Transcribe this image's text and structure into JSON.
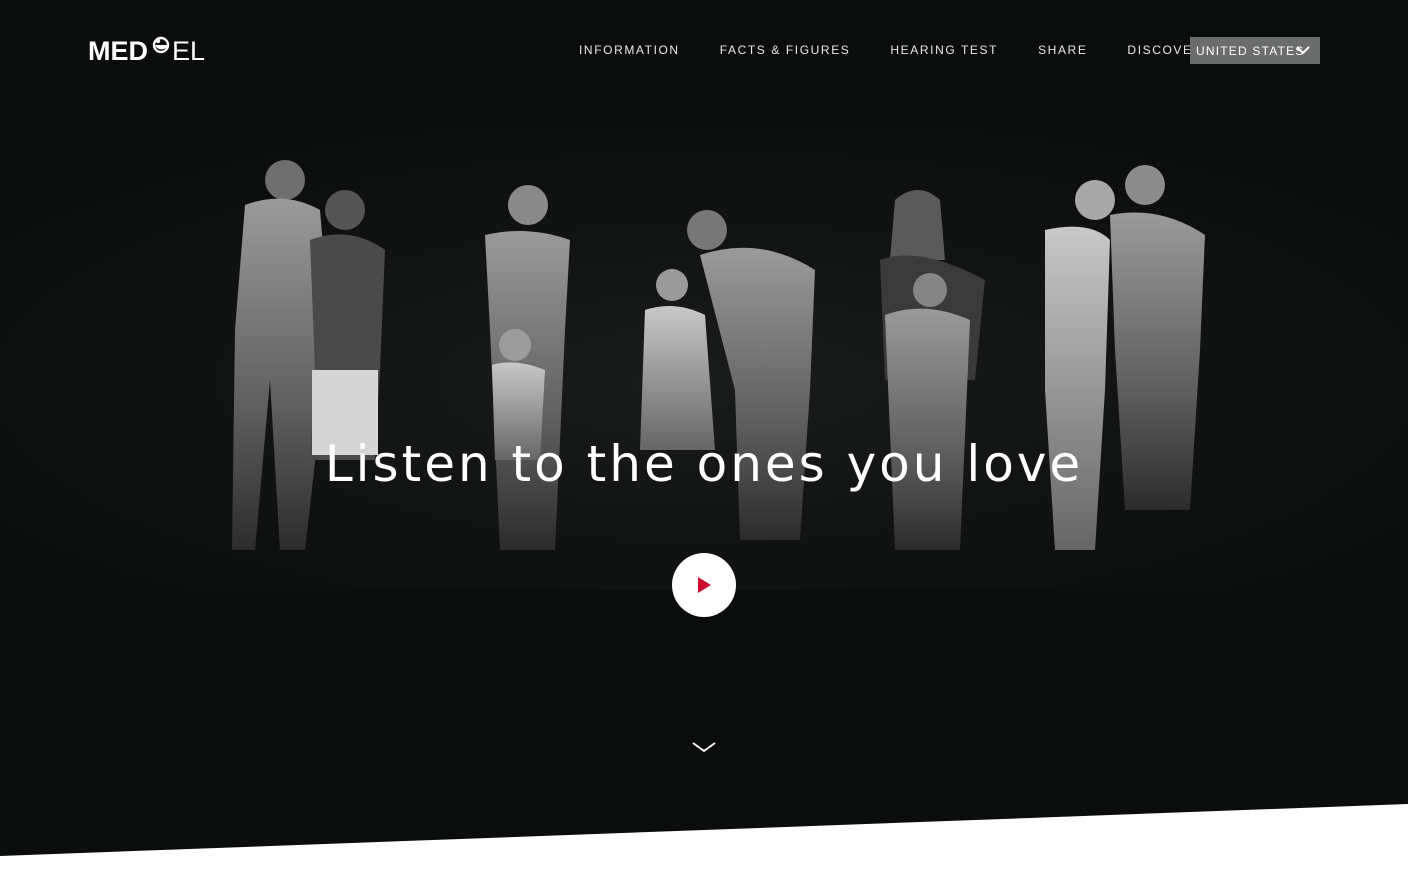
{
  "brand": {
    "logo_left": "MED",
    "logo_right": "EL",
    "accent_color": "#c8102e"
  },
  "nav": {
    "items": [
      {
        "label": "INFORMATION"
      },
      {
        "label": "FACTS & FIGURES"
      },
      {
        "label": "HEARING TEST"
      },
      {
        "label": "SHARE"
      },
      {
        "label": "DISCOVER"
      }
    ],
    "country_selector": {
      "label": "UNITED STATES",
      "icon": "chevron-down-icon"
    }
  },
  "hero": {
    "headline": "Listen to the ones you love",
    "play_icon": "play-icon",
    "scroll_icon": "chevron-down-icon",
    "image_description_icon": "families-photo"
  },
  "colors": {
    "background": "#0b0d0d",
    "selector_bg": "#6b6d6d",
    "text": "#ffffff"
  }
}
